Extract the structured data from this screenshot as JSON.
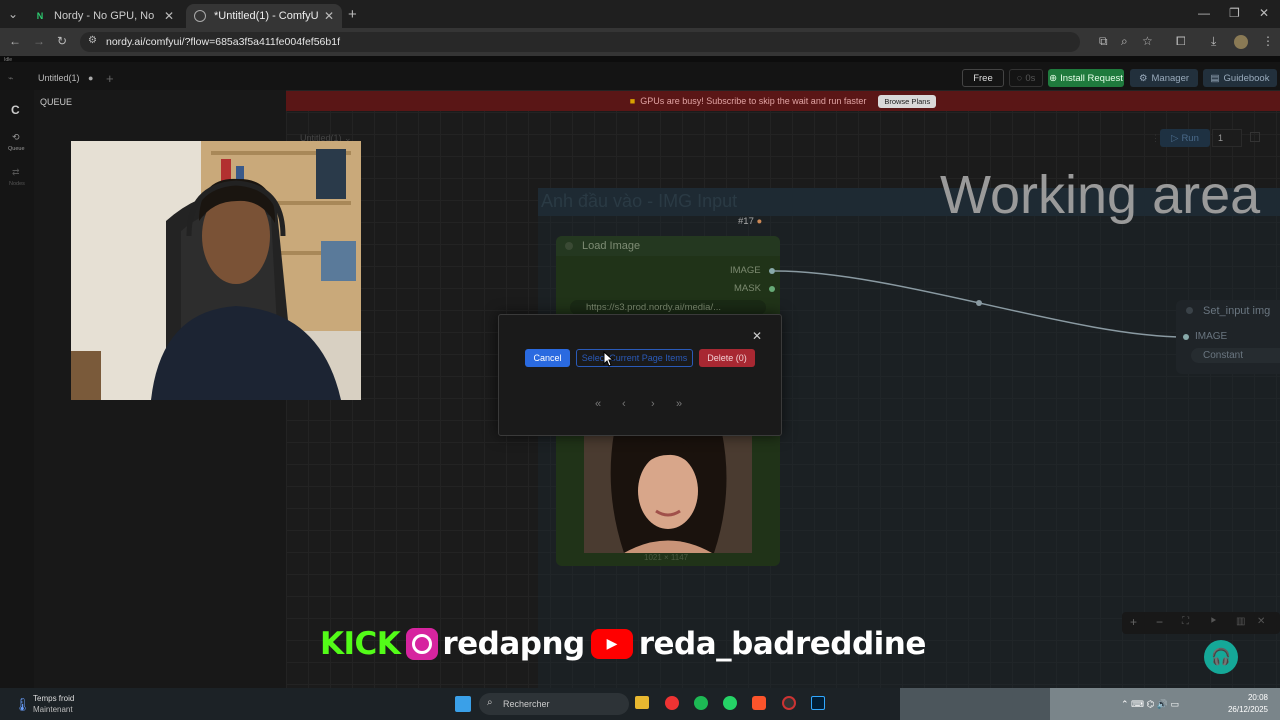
{
  "browser": {
    "tabs": [
      {
        "label": "Nordy - No GPU, No Install. Ru",
        "icon": "N"
      },
      {
        "label": "*Untitled(1) - ComfyUI",
        "icon": "globe"
      }
    ],
    "url": "nordy.ai/comfyui/?flow=685a3f5a411fe004fef56b1f"
  },
  "app": {
    "idle_label": "Idle",
    "workflow_tab": "Untitled(1)",
    "canvas_tab": "Untitled(1)",
    "sidebar": {
      "queue": "Queue",
      "nodes": "Nodes"
    },
    "queue_title": "QUEUE",
    "top_buttons": {
      "free": "Free",
      "zero": "0s",
      "install": "Install Request",
      "manager": "Manager",
      "guidebook": "Guidebook"
    },
    "banner": {
      "text": "GPUs are busy! Subscribe to skip the wait and run faster",
      "button": "Browse Plans"
    },
    "run": {
      "label": "Run",
      "count": "1"
    }
  },
  "canvas": {
    "group_title": "Anh đầu vào - IMG Input",
    "working_area": "Working area",
    "node_badge": "#17",
    "load_image": {
      "title": "Load Image",
      "outputs": [
        "IMAGE",
        "MASK"
      ],
      "url_field": "https://s3.prod.nordy.ai/media/...",
      "image_size": "1021 × 1147"
    },
    "set_input": {
      "title": "Set_input img",
      "input": "IMAGE",
      "constant": "Constant"
    }
  },
  "dialog": {
    "cancel": "Cancel",
    "select_page": "Select Current Page Items",
    "delete": "Delete (0)",
    "pager": [
      "«",
      "‹",
      "›",
      "»"
    ]
  },
  "overlay": {
    "kick": "KICK",
    "instagram": "redapng",
    "youtube": "reda_badreddine"
  },
  "taskbar": {
    "weather_title": "Temps froid",
    "weather_sub": "Maintenant",
    "search": "Rechercher",
    "time": "20:08",
    "date": "26/12/2025"
  }
}
